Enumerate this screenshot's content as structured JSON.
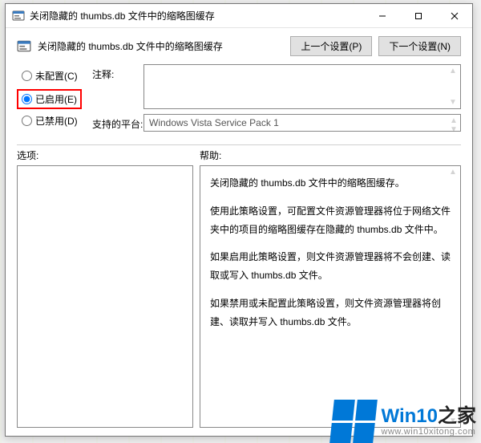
{
  "window": {
    "title": "关闭隐藏的 thumbs.db 文件中的缩略图缓存"
  },
  "header": {
    "title": "关闭隐藏的 thumbs.db 文件中的缩略图缓存",
    "prev_btn": "上一个设置(P)",
    "next_btn": "下一个设置(N)"
  },
  "radios": {
    "not_configured": "未配置(C)",
    "enabled": "已启用(E)",
    "disabled": "已禁用(D)"
  },
  "fields": {
    "comment_label": "注释:",
    "platform_label": "支持的平台:",
    "platform_value": "Windows Vista Service Pack 1"
  },
  "sections": {
    "options": "选项:",
    "help": "帮助:"
  },
  "help": {
    "p1": "关闭隐藏的 thumbs.db 文件中的缩略图缓存。",
    "p2": "使用此策略设置，可配置文件资源管理器将位于网络文件夹中的项目的缩略图缓存在隐藏的 thumbs.db 文件中。",
    "p3": "如果启用此策略设置，则文件资源管理器将不会创建、读取或写入 thumbs.db 文件。",
    "p4": "如果禁用或未配置此策略设置，则文件资源管理器将创建、读取并写入 thumbs.db 文件。"
  },
  "watermark": {
    "brand1": "Win10",
    "brand2": "之家",
    "url": "www.win10xitong.com"
  }
}
